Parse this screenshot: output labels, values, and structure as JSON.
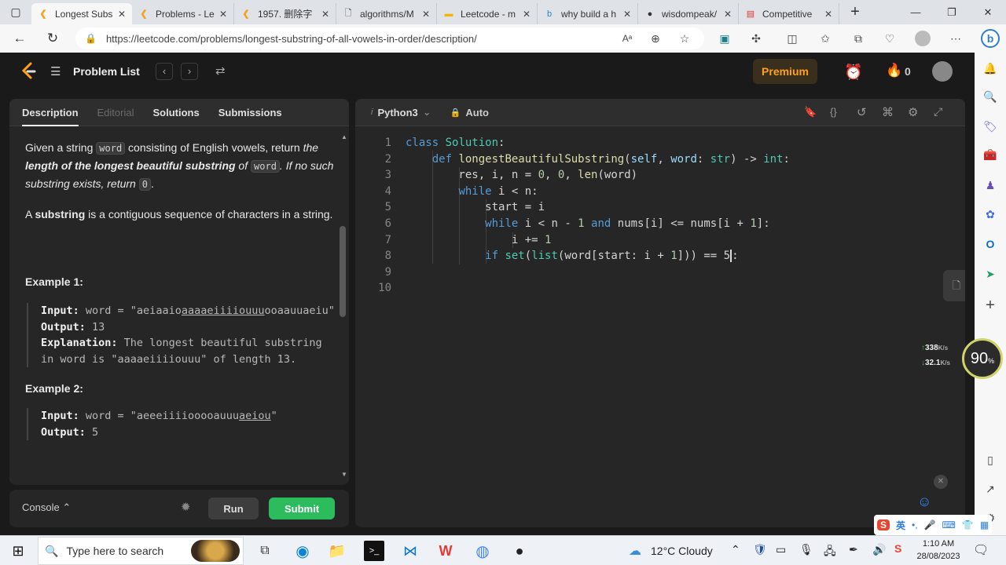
{
  "browser": {
    "tabs": [
      {
        "title": "Longest Subs",
        "active": true
      },
      {
        "title": "Problems - Le"
      },
      {
        "title": "1957. 删除字"
      },
      {
        "title": "algorithms/M"
      },
      {
        "title": "Leetcode - m"
      },
      {
        "title": "why build a h"
      },
      {
        "title": "wisdompeak/"
      },
      {
        "title": "Competitive"
      }
    ],
    "url": "https://leetcode.com/problems/longest-substring-of-all-vowels-in-order/description/"
  },
  "leetcode": {
    "nav": {
      "problem_list": "Problem List",
      "premium": "Premium",
      "streak": "0"
    },
    "tabs": [
      "Description",
      "Editorial",
      "Solutions",
      "Submissions"
    ],
    "description": {
      "p1": {
        "a": "Given a string ",
        "code1": "word",
        "b": " consisting of English vowels, return ",
        "i1": "the ",
        "bi": "length of the longest beautiful substring",
        "i2": " of ",
        "code2": "word",
        "i3": ". If no such substring exists, return ",
        "code3": "0",
        "end": "."
      },
      "p2": {
        "a": "A ",
        "b": "substring",
        "c": " is a contiguous sequence of characters in a string."
      },
      "ex1": {
        "title": "Example 1:",
        "input_label": "Input:",
        "input_pre": " word = \"aeiaaio",
        "input_u": "aaaaeiiiiouuu",
        "input_post": "ooaauuaeiu\"",
        "output_label": "Output:",
        "output": " 13",
        "expl_label": "Explanation:",
        "expl": " The longest beautiful substring in word is \"aaaaeiiiiouuu\" of length 13."
      },
      "ex2": {
        "title": "Example 2:",
        "input_label": "Input:",
        "input_pre": " word = \"aeeeiiiiooooauuu",
        "input_u": "aeiou",
        "input_post": "\"",
        "output_label": "Output:",
        "output": " 5"
      }
    },
    "console": {
      "label": "Console",
      "run": "Run",
      "submit": "Submit"
    },
    "editor": {
      "language": "Python3",
      "mode": "Auto",
      "line_numbers": [
        "1",
        "2",
        "3",
        "4",
        "5",
        "6",
        "7",
        "8",
        "9",
        "10"
      ]
    }
  },
  "overlay": {
    "up": "338",
    "down": "32.1",
    "unit": "K/s",
    "percent": "90",
    "percent_unit": "%"
  },
  "taskbar": {
    "search": "Type here to search",
    "weather": "12°C  Cloudy",
    "time": "1:10 AM",
    "date": "28/08/2023",
    "ime": "英"
  }
}
